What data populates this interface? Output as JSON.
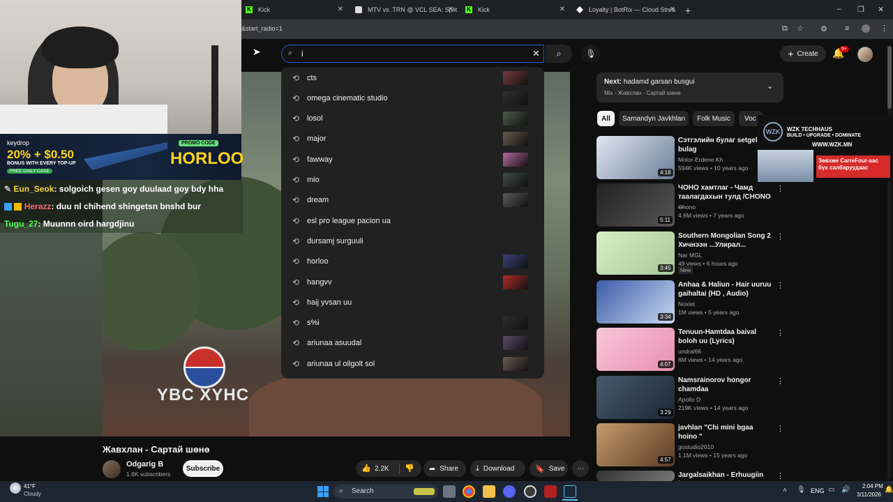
{
  "browser": {
    "tabs": [
      {
        "title": "Kick",
        "icon": "kick-icon"
      },
      {
        "title": "MTV vs. TRN @ VCL SEA: Split",
        "icon": "video-icon"
      },
      {
        "title": "Kick",
        "icon": "kick-icon"
      },
      {
        "title": "Loyalty | BotRix — Cloud Strea",
        "icon": "botrix-icon"
      }
    ],
    "url": "&start_radio=1"
  },
  "youtube": {
    "search": {
      "value": "i",
      "placeholder": ""
    },
    "suggestions": [
      "cts",
      "omega cinematic studio",
      "losol",
      "major",
      "fawway",
      "mio",
      "dream",
      "esl pro league pacion ua",
      "dursamj surguuli",
      "horloo",
      "hangvv",
      "haij yvsan uu",
      "s%i",
      "ariunaa asuudal",
      "ariunaa ul oilgolt sol"
    ],
    "create_label": "Create",
    "notif_count": "9+",
    "video_overlay_text": "YBC XYHC",
    "next": {
      "label": "Next:",
      "title": "hadamd garsan busgui",
      "subtitle": "Mix - Жавхлан - Сартай шөнө"
    },
    "chips": [
      "All",
      "Samandyn Javkhlan",
      "Folk Music",
      "Voc"
    ],
    "video_title": "Жавхлан - Сартай шөнө",
    "channel": {
      "name": "Odgarig B",
      "subs": "1.6K subscribers",
      "subscribe": "Subscribe"
    },
    "actions": {
      "likes": "2.2K",
      "share": "Share",
      "download": "Download",
      "save": "Save"
    },
    "related": [
      {
        "title": "Сэтгэлийн булаг setgeliin bulag",
        "channel": "Molor-Erdene Kh",
        "meta": "594K views • 10 years ago",
        "duration": "4:18"
      },
      {
        "title": "ЧОНО хамтлаг - Чамд таалагдахын тулд /CHONO ...",
        "channel": "Chono",
        "meta": "4.6M views • 7 years ago",
        "duration": "5:11"
      },
      {
        "title": "Southern Mongolian Song 2 Хичнээн ...Улирал...",
        "channel": "Nar MGL",
        "meta": "49 views • 6 hours ago",
        "duration": "3:45",
        "badge": "New"
      },
      {
        "title": "Anhaa & Haliun - Hair uuruu gaihaltai (HD , Audio)",
        "channel": "Noxiet",
        "meta": "1M views • 5 years ago",
        "duration": "3:34"
      },
      {
        "title": "Tenuun-Hamtdaa baival boloh uu (Lyrics)",
        "channel": "undral66",
        "meta": "6M views • 14 years ago",
        "duration": "4:07"
      },
      {
        "title": "Namsrainorov hongor chamdaa",
        "channel": "Apollo D",
        "meta": "219K views • 14 years ago",
        "duration": "3:29"
      },
      {
        "title": "javhlan \"Chi mini bgaa hoino \"",
        "channel": "gostudio2010",
        "meta": "1.1M views • 15 years ago",
        "duration": "4:57"
      },
      {
        "title": "Jargalsaikhan - Erhuugiin havar",
        "channel": "",
        "meta": "",
        "duration": ""
      }
    ]
  },
  "stream": {
    "ad": {
      "brand": "keydrop",
      "promo": "20% + $0.50",
      "promo_sub": "BONUS WITH EVERY TOP-UP",
      "daily": "FREE DAILY CASE",
      "code_label": "PROMO CODE",
      "code": "HORLOO"
    },
    "chat": [
      {
        "user": "Eun_Seok",
        "msg": ": solgoich gesen goy duulaad goy bdy hha",
        "color": "#f5d547"
      },
      {
        "user": "Herazz",
        "msg": ": duu nl chihend shingetsn bnshd bur",
        "color": "#ff6b6b"
      },
      {
        "user": "Tugu_27",
        "msg": ": Muunnn oird hargdjinu",
        "color": "#4cff4c"
      }
    ],
    "sponsor": {
      "name": "WZK TECHHAUS",
      "tagline": "BUILD • UPGRADE • DOMINATE",
      "url": "WWW.WZK.MN",
      "banner": "Зөвхөн CarreFour-аас бүх салбаруудаас"
    }
  },
  "taskbar": {
    "weather_temp": "41°F",
    "weather_desc": "Cloudy",
    "search_label": "Search",
    "lang": "ENG",
    "time": "2:04 PM",
    "date": "3/11/2026"
  }
}
